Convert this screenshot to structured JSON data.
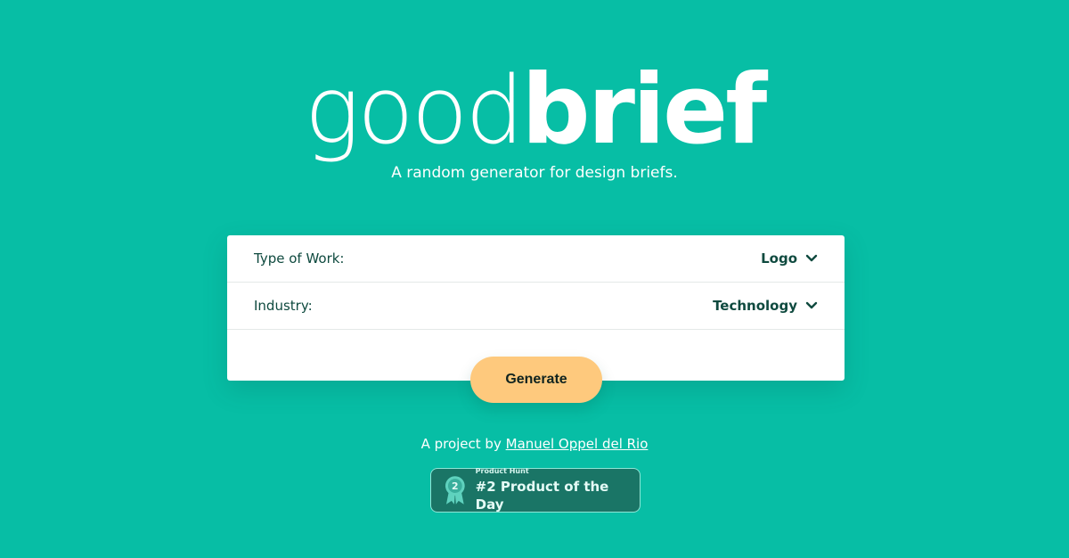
{
  "logo": {
    "part1": "good",
    "part2": "brief"
  },
  "tagline": "A random generator for design briefs.",
  "form": {
    "rows": [
      {
        "label": "Type of Work:",
        "value": "Logo",
        "icon": "chevron-down-icon"
      },
      {
        "label": "Industry:",
        "value": "Technology",
        "icon": "chevron-down-icon"
      }
    ],
    "generate_label": "Generate"
  },
  "footer": {
    "credit_prefix": "A project by",
    "author": "Manuel Oppel del Rio"
  },
  "badge": {
    "small": "Product Hunt",
    "big": "#2 Product of the Day",
    "rank": "2",
    "icon": "medal-icon"
  },
  "colors": {
    "background": "#07bea5",
    "button": "#fec97d",
    "text_dark": "#0f4a3f",
    "badge_bg": "#1a7566"
  }
}
